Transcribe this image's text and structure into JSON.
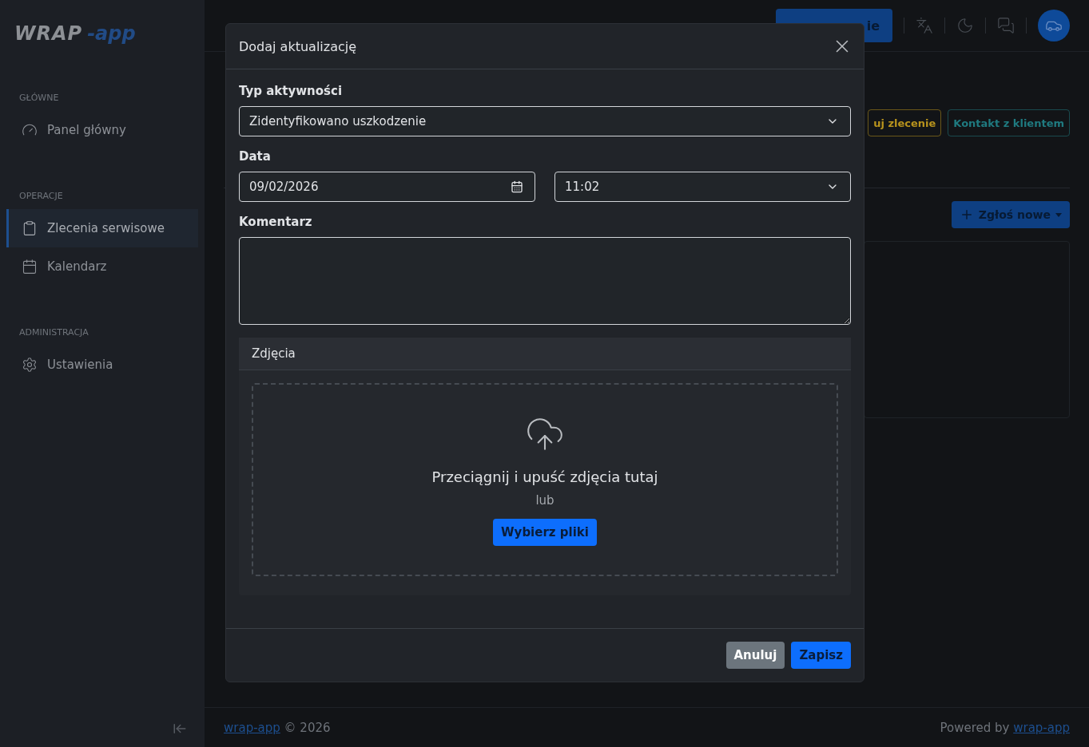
{
  "logo": {
    "word": "WRAP",
    "suffix": "-app"
  },
  "sidebar": {
    "sections": [
      {
        "heading": "GŁÓWNE",
        "items": [
          {
            "label": "Panel główny",
            "selected": false
          }
        ]
      },
      {
        "heading": "OPERACJE",
        "items": [
          {
            "label": "Zlecenia serwisowe",
            "selected": true
          },
          {
            "label": "Kalendarz",
            "selected": false
          }
        ]
      },
      {
        "heading": "ADMINISTRACJA",
        "items": [
          {
            "label": "Ustawienia",
            "selected": false
          }
        ]
      }
    ]
  },
  "header": {
    "primary_button": "ie"
  },
  "actions": [
    {
      "label": "uj zlecenie",
      "color": "#b8931d"
    },
    {
      "label": "Kontakt z klientem",
      "color": "#1f7a80"
    }
  ],
  "report_button": {
    "label": "Zgłoś nowe"
  },
  "modal": {
    "title": "Dodaj aktualizację",
    "activity": {
      "label": "Typ aktywności",
      "value": "Zidentyfikowano uszkodzenie"
    },
    "date": {
      "label": "Data",
      "value": "09/02/2026",
      "time": "11:02"
    },
    "comment": {
      "label": "Komentarz"
    },
    "photos": {
      "title": "Zdjęcia",
      "drop_text": "Przeciągnij i upuść zdjęcia tutaj",
      "or": "lub",
      "button": "Wybierz pliki"
    },
    "buttons": [
      {
        "label": "Anuluj",
        "kind": "secondary"
      },
      {
        "label": "Zapisz",
        "kind": "primary"
      }
    ]
  },
  "footer": {
    "link": "wrap-app",
    "copyright": "© 2026",
    "powered": "Powered by",
    "powered_link": "wrap-app"
  }
}
